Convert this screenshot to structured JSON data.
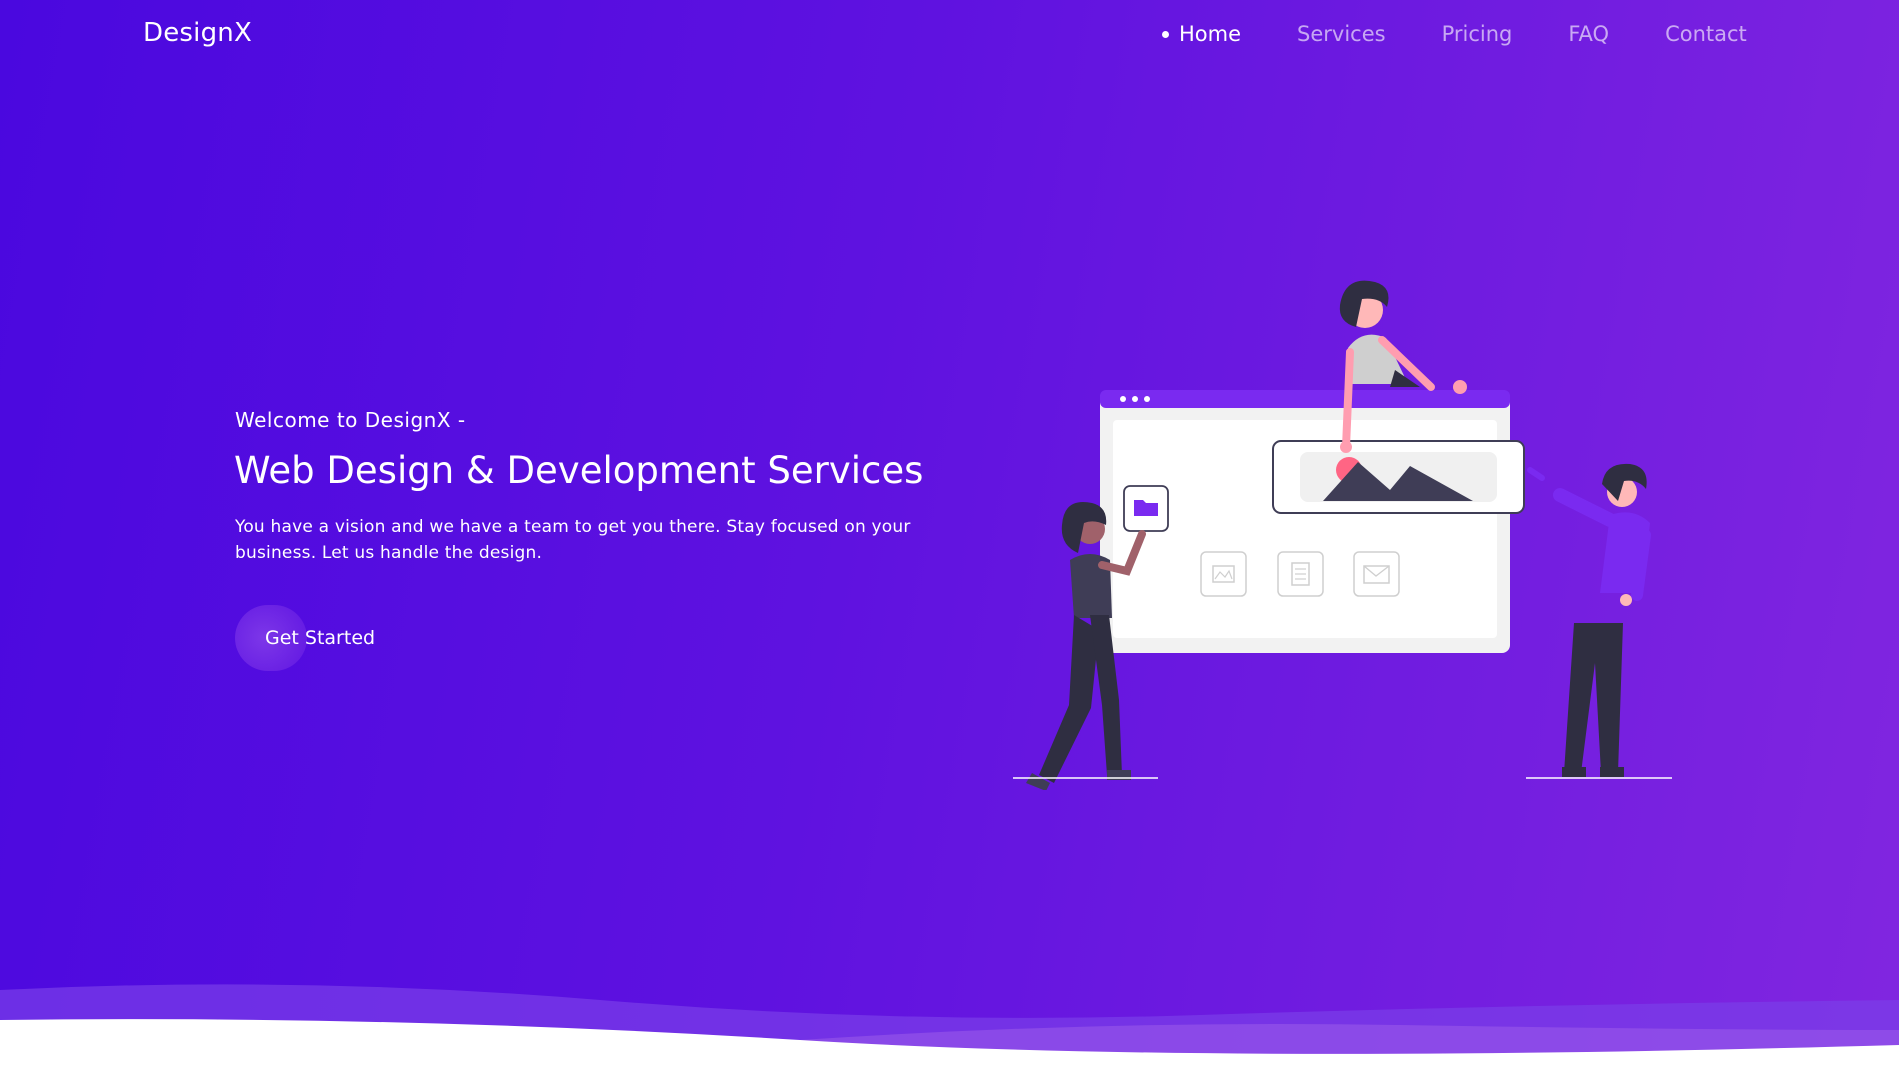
{
  "brand": {
    "logo": "DesignX"
  },
  "nav": {
    "items": [
      {
        "label": "Home",
        "active": true
      },
      {
        "label": "Services",
        "active": false
      },
      {
        "label": "Pricing",
        "active": false
      },
      {
        "label": "FAQ",
        "active": false
      },
      {
        "label": "Contact",
        "active": false
      }
    ]
  },
  "hero": {
    "welcome": "Welcome to DesignX -",
    "headline": "Web Design & Development Services",
    "description": "You have a vision and we have a team to get you there. Stay focused on your business. Let us handle the design.",
    "cta_label": "Get Started"
  },
  "colors": {
    "gradient_start": "#4a08df",
    "gradient_end": "#8126e0",
    "accent": "#7a2af0",
    "dark": "#3f3d56",
    "pink": "#ff6584"
  },
  "icons": [
    "folder-icon",
    "image-icon",
    "document-icon",
    "mail-icon",
    "picture-icon"
  ]
}
